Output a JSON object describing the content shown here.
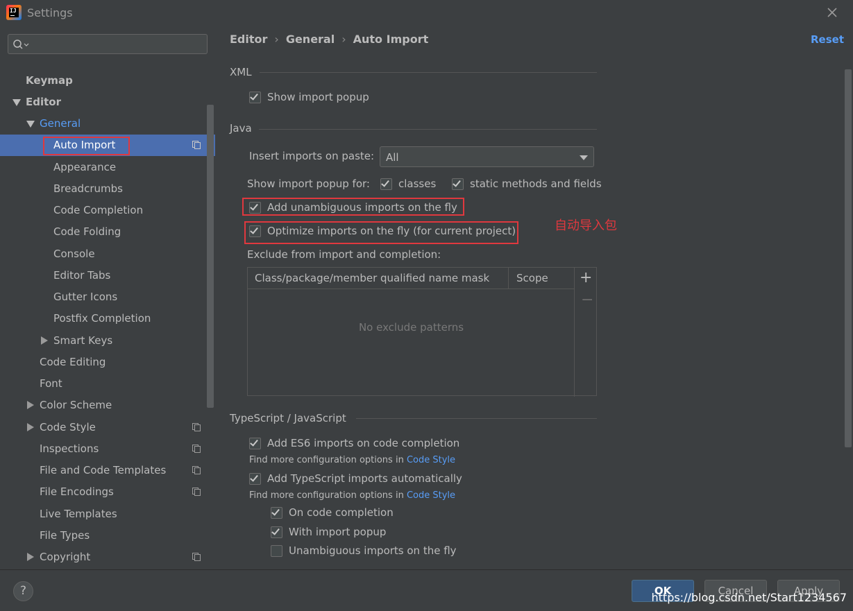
{
  "window": {
    "title": "Settings"
  },
  "search": {
    "placeholder": ""
  },
  "tree": {
    "keymap": "Keymap",
    "editor": "Editor",
    "general": "General",
    "auto_import": "Auto Import",
    "appearance": "Appearance",
    "breadcrumbs": "Breadcrumbs",
    "code_completion": "Code Completion",
    "code_folding": "Code Folding",
    "console": "Console",
    "editor_tabs": "Editor Tabs",
    "gutter_icons": "Gutter Icons",
    "postfix_completion": "Postfix Completion",
    "smart_keys": "Smart Keys",
    "code_editing": "Code Editing",
    "font": "Font",
    "color_scheme": "Color Scheme",
    "code_style": "Code Style",
    "inspections": "Inspections",
    "file_code_templates": "File and Code Templates",
    "file_encodings": "File Encodings",
    "live_templates": "Live Templates",
    "file_types": "File Types",
    "copyright": "Copyright"
  },
  "breadcrumb": {
    "items": [
      "Editor",
      "General",
      "Auto Import"
    ],
    "reset": "Reset"
  },
  "xml": {
    "title": "XML",
    "show_import_popup": {
      "label": "Show import popup",
      "checked": true
    }
  },
  "java": {
    "title": "Java",
    "insert_imports_label": "Insert imports on paste:",
    "insert_imports_value": "All",
    "show_popup_for": "Show import popup for:",
    "classes": {
      "label": "classes",
      "checked": true
    },
    "static_methods": {
      "label": "static methods and fields",
      "checked": true
    },
    "add_unambiguous": {
      "label": "Add unambiguous imports on the fly",
      "checked": true
    },
    "optimize_imports": {
      "label": "Optimize imports on the fly (for current project)",
      "checked": true
    },
    "exclude_label": "Exclude from import and completion:",
    "table": {
      "col_mask": "Class/package/member qualified name mask",
      "col_scope": "Scope",
      "empty": "No exclude patterns",
      "add": "+",
      "remove": "−"
    }
  },
  "annotation": "自动导入包",
  "ts": {
    "title": "TypeScript / JavaScript",
    "add_es6": {
      "label": "Add ES6 imports on code completion",
      "checked": true
    },
    "find_more_1": "Find more configuration options in ",
    "code_style_link_1": "Code Style",
    "add_ts": {
      "label": "Add TypeScript imports automatically",
      "checked": true
    },
    "find_more_2": "Find more configuration options in ",
    "code_style_link_2": "Code Style",
    "on_completion": {
      "label": "On code completion",
      "checked": true
    },
    "with_popup": {
      "label": "With import popup",
      "checked": true
    },
    "unambiguous": {
      "label": "Unambiguous imports on the fly",
      "checked": false
    }
  },
  "buttons": {
    "help": "?",
    "ok": "OK",
    "cancel": "Cancel",
    "apply": "Apply"
  },
  "watermark": "https://blog.csdn.net/Start1234567",
  "colors": {
    "background": "#3c3f41",
    "selection": "#4b6eaf",
    "link": "#589df6",
    "highlight_box": "#e0383e",
    "primary_button": "#365880"
  }
}
